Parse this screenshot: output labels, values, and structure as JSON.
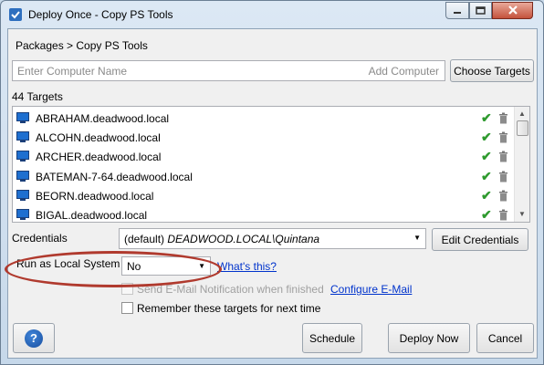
{
  "window": {
    "title": "Deploy Once - Copy PS Tools"
  },
  "breadcrumb": "Packages > Copy PS Tools",
  "computer_input": {
    "placeholder": "Enter Computer Name",
    "add_hint": "Add Computer"
  },
  "choose_targets_label": "Choose Targets",
  "targets": {
    "count_label": "44 Targets",
    "items": [
      {
        "name": "ABRAHAM.deadwood.local"
      },
      {
        "name": "ALCOHN.deadwood.local"
      },
      {
        "name": "ARCHER.deadwood.local"
      },
      {
        "name": "BATEMAN-7-64.deadwood.local"
      },
      {
        "name": "BEORN.deadwood.local"
      },
      {
        "name": "BIGAL.deadwood.local"
      }
    ]
  },
  "credentials": {
    "label": "Credentials",
    "prefix": "(default) ",
    "value": "DEADWOOD.LOCAL\\Quintana",
    "edit_label": "Edit Credentials"
  },
  "run_as": {
    "label": "Run as Local System",
    "value": "No",
    "whats_this": "What's this?"
  },
  "email": {
    "label": "Send E-Mail Notification when finished",
    "configure_label": "Configure E-Mail"
  },
  "remember": {
    "label": "Remember these targets for next time"
  },
  "buttons": {
    "help": "?",
    "schedule": "Schedule",
    "deploy_now": "Deploy Now",
    "cancel": "Cancel"
  },
  "colors": {
    "accent": "#0033cc",
    "check": "#2e9a2e",
    "highlight": "#b03a2e",
    "help": "#1a4fa0"
  }
}
